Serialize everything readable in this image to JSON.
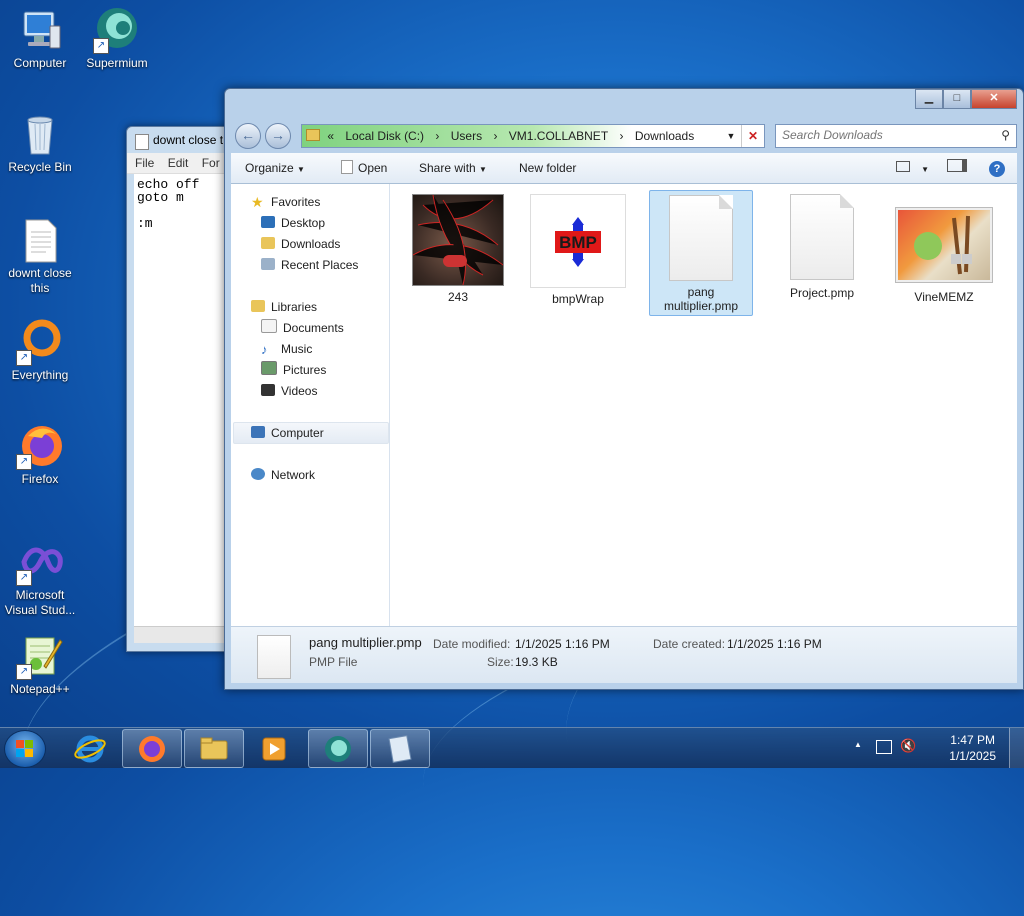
{
  "desktop": {
    "icons": [
      {
        "label": "Computer",
        "icon": "computer-icon"
      },
      {
        "label": "Supermium",
        "icon": "supermium-icon"
      },
      {
        "label": "Recycle Bin",
        "icon": "recycle-bin-icon"
      },
      {
        "label": "downt close this",
        "icon": "text-file-icon"
      },
      {
        "label": "Everything",
        "icon": "everything-icon"
      },
      {
        "label": "Firefox",
        "icon": "firefox-icon"
      },
      {
        "label": "Microsoft Visual Stud...",
        "icon": "visual-studio-icon"
      },
      {
        "label": "Notepad++",
        "icon": "notepadpp-icon"
      }
    ]
  },
  "notepad": {
    "title": "downt close t",
    "menu": [
      "File",
      "Edit",
      "For"
    ],
    "content": "echo off\ngoto m\n\n:m"
  },
  "explorer": {
    "address": {
      "prefix": "«",
      "crumbs": [
        "Local Disk (C:)",
        "Users",
        "VM1.COLLABNET",
        "Downloads"
      ],
      "separator": "›"
    },
    "search_placeholder": "Search Downloads",
    "toolbar": {
      "organize": "Organize",
      "open": "Open",
      "share_with": "Share with",
      "new_folder": "New folder"
    },
    "sidebar": {
      "favorites": "Favorites",
      "desktop": "Desktop",
      "downloads": "Downloads",
      "recent_places": "Recent Places",
      "libraries": "Libraries",
      "documents": "Documents",
      "music": "Music",
      "pictures": "Pictures",
      "videos": "Videos",
      "computer": "Computer",
      "network": "Network"
    },
    "files": [
      {
        "name": "243",
        "type": "image-thumbnail"
      },
      {
        "name": "bmpWrap",
        "type": "bmp-thumbnail",
        "badge": "BMP"
      },
      {
        "name": "pang multiplier.pmp",
        "type": "document",
        "selected": true
      },
      {
        "name": "Project.pmp",
        "type": "document"
      },
      {
        "name": "VineMEMZ",
        "type": "paint-thumbnail"
      }
    ],
    "details": {
      "filename": "pang multiplier.pmp",
      "filetype": "PMP File",
      "modified_label": "Date modified:",
      "modified_value": "1/1/2025 1:16 PM",
      "size_label": "Size:",
      "size_value": "19.3 KB",
      "created_label": "Date created:",
      "created_value": "1/1/2025 1:16 PM"
    }
  },
  "taskbar": {
    "time": "1:47 PM",
    "date": "1/1/2025",
    "tray_arrow": "▲"
  },
  "colors": {
    "desktop_bg": "#1a6fc9",
    "selection": "#cde6f7",
    "address_progress": "#7fd27f"
  }
}
